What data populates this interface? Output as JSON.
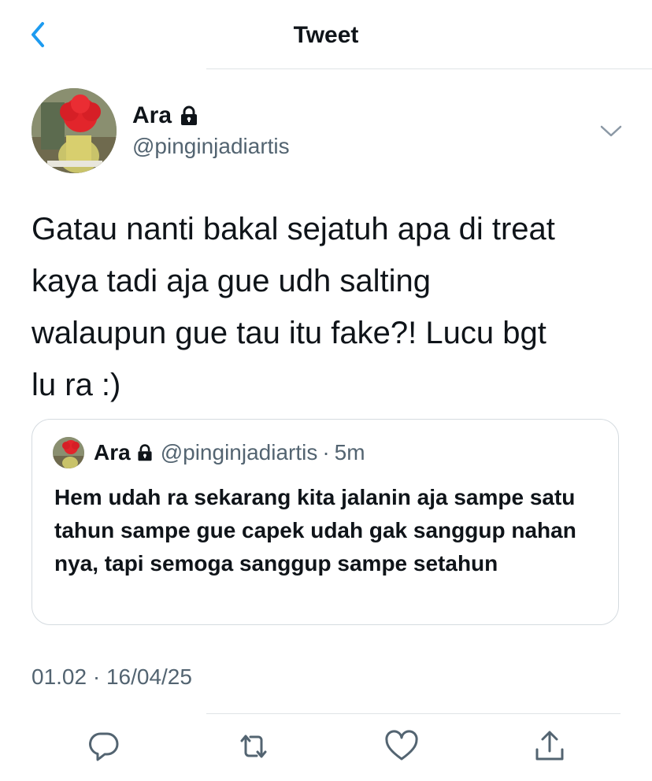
{
  "header": {
    "title": "Tweet",
    "back_icon": "chevron-left-icon"
  },
  "tweet": {
    "author": {
      "display_name": "Ara",
      "handle": "@pinginjadiartis",
      "protected": true,
      "lock_icon": "lock-icon"
    },
    "text": "Gatau nanti bakal sejatuh apa di treat\nkaya tadi aja gue udh salting\nwalaupun gue tau itu fake?! Lucu bgt\nlu ra :)",
    "timestamp": "01.02 · 16/04/25",
    "quoted": {
      "display_name": "Ara",
      "handle": "@pinginjadiartis",
      "separator": "·",
      "time": "5m",
      "text": "Hem udah ra sekarang kita jalanin aja sampe satu tahun sampe gue capek udah gak sanggup nahan nya, tapi semoga sanggup sampe setahun"
    }
  },
  "actions": {
    "reply_icon": "reply-icon",
    "retweet_icon": "retweet-icon",
    "like_icon": "heart-icon",
    "share_icon": "share-icon"
  },
  "colors": {
    "accent": "#1d9bf0",
    "primary_text": "#0f1419",
    "secondary_text": "#536471",
    "divider": "#dfe3e6",
    "card_border": "#d5dbe0"
  }
}
